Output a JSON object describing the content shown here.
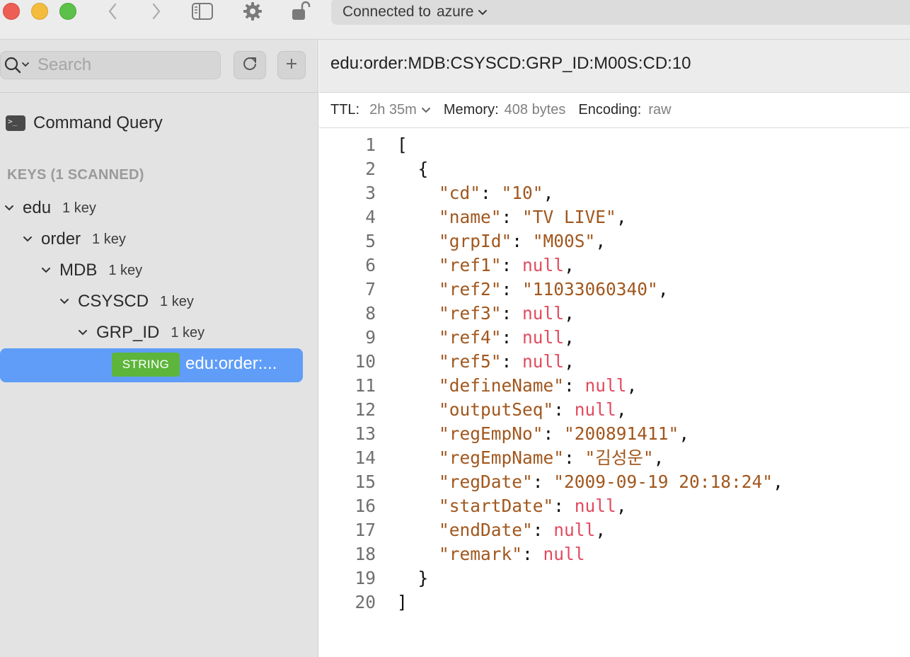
{
  "toolbar": {
    "connection_label": "Connected to",
    "connection_name": "azure"
  },
  "sidebar": {
    "search_placeholder": "Search",
    "command_query": "Command Query",
    "keys_heading": "KEYS (1 SCANNED)",
    "tree": [
      {
        "label": "edu",
        "count": "1 key"
      },
      {
        "label": "order",
        "count": "1 key"
      },
      {
        "label": "MDB",
        "count": "1 key"
      },
      {
        "label": "CSYSCD",
        "count": "1 key"
      },
      {
        "label": "GRP_ID",
        "count": "1 key"
      }
    ],
    "selected": {
      "type": "STRING",
      "label": "edu:order:..."
    }
  },
  "main": {
    "key_name": "edu:order:MDB:CSYSCD:GRP_ID:M00S:CD:10",
    "ttl_label": "TTL:",
    "ttl_value": "2h 35m",
    "memory_label": "Memory:",
    "memory_value": "408 bytes",
    "encoding_label": "Encoding:",
    "encoding_value": "raw"
  },
  "code_lines": [
    {
      "n": "1",
      "indent": "",
      "key": null,
      "val": null,
      "kind": "punct",
      "text": "["
    },
    {
      "n": "2",
      "indent": "  ",
      "key": null,
      "val": null,
      "kind": "punct",
      "text": "{"
    },
    {
      "n": "3",
      "indent": "    ",
      "key": "cd",
      "val": "10",
      "kind": "string",
      "comma": true
    },
    {
      "n": "4",
      "indent": "    ",
      "key": "name",
      "val": "TV LIVE",
      "kind": "string",
      "comma": true
    },
    {
      "n": "5",
      "indent": "    ",
      "key": "grpId",
      "val": "M00S",
      "kind": "string",
      "comma": true
    },
    {
      "n": "6",
      "indent": "    ",
      "key": "ref1",
      "val": "null",
      "kind": "null",
      "comma": true
    },
    {
      "n": "7",
      "indent": "    ",
      "key": "ref2",
      "val": "11033060340",
      "kind": "string",
      "comma": true
    },
    {
      "n": "8",
      "indent": "    ",
      "key": "ref3",
      "val": "null",
      "kind": "null",
      "comma": true
    },
    {
      "n": "9",
      "indent": "    ",
      "key": "ref4",
      "val": "null",
      "kind": "null",
      "comma": true
    },
    {
      "n": "10",
      "indent": "    ",
      "key": "ref5",
      "val": "null",
      "kind": "null",
      "comma": true
    },
    {
      "n": "11",
      "indent": "    ",
      "key": "defineName",
      "val": "null",
      "kind": "null",
      "comma": true
    },
    {
      "n": "12",
      "indent": "    ",
      "key": "outputSeq",
      "val": "null",
      "kind": "null",
      "comma": true
    },
    {
      "n": "13",
      "indent": "    ",
      "key": "regEmpNo",
      "val": "200891411",
      "kind": "string",
      "comma": true
    },
    {
      "n": "14",
      "indent": "    ",
      "key": "regEmpName",
      "val": "김성운",
      "kind": "string",
      "comma": true
    },
    {
      "n": "15",
      "indent": "    ",
      "key": "regDate",
      "val": "2009-09-19 20:18:24",
      "kind": "string",
      "comma": true
    },
    {
      "n": "16",
      "indent": "    ",
      "key": "startDate",
      "val": "null",
      "kind": "null",
      "comma": true
    },
    {
      "n": "17",
      "indent": "    ",
      "key": "endDate",
      "val": "null",
      "kind": "null",
      "comma": true
    },
    {
      "n": "18",
      "indent": "    ",
      "key": "remark",
      "val": "null",
      "kind": "null",
      "comma": false
    },
    {
      "n": "19",
      "indent": "  ",
      "key": null,
      "val": null,
      "kind": "punct",
      "text": "}"
    },
    {
      "n": "20",
      "indent": "",
      "key": null,
      "val": null,
      "kind": "punct",
      "text": "]"
    }
  ],
  "colors": {
    "selection": "#5f9df8",
    "string_badge": "#5db53b",
    "json_string": "#a1571e",
    "json_null": "#e14b5e"
  },
  "icons": [
    "back-icon",
    "forward-icon",
    "sidebar-toggle-icon",
    "gear-icon",
    "unlock-icon",
    "search-icon",
    "refresh-icon",
    "plus-icon",
    "terminal-icon",
    "chevron-down-icon"
  ]
}
